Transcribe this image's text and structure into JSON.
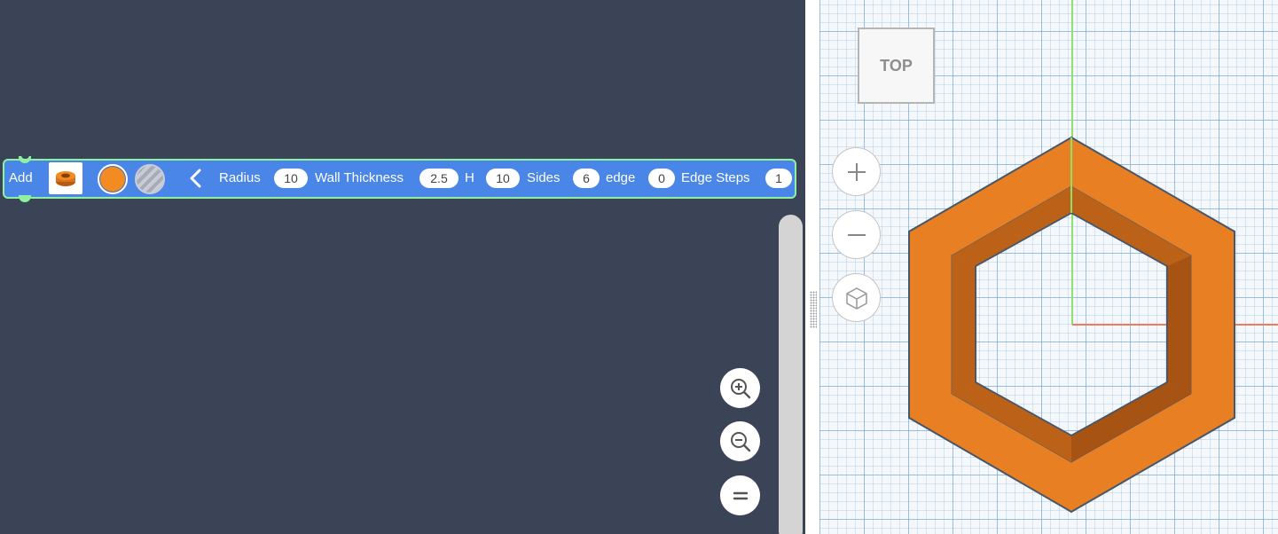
{
  "block": {
    "add_label": "Add",
    "fields": [
      {
        "label": "Radius",
        "value": "10"
      },
      {
        "label": "Wall Thickness",
        "value": "2.5"
      },
      {
        "label": "H",
        "value": "10"
      },
      {
        "label": "Sides",
        "value": "6"
      },
      {
        "label": "edge",
        "value": "0"
      },
      {
        "label": "Edge Steps",
        "value": "1"
      }
    ],
    "colors": {
      "selected": "#f28c22",
      "block": "#4a86e8",
      "outline": "#8ff0a0"
    }
  },
  "workspace_controls": [
    "zoom-in-icon",
    "zoom-out-icon",
    "reset-zoom-icon"
  ],
  "viewport": {
    "viewcube_label": "TOP",
    "nav_controls": [
      "plus-icon",
      "minus-icon",
      "home-cube-icon"
    ],
    "shape_color": "#e87f23"
  }
}
